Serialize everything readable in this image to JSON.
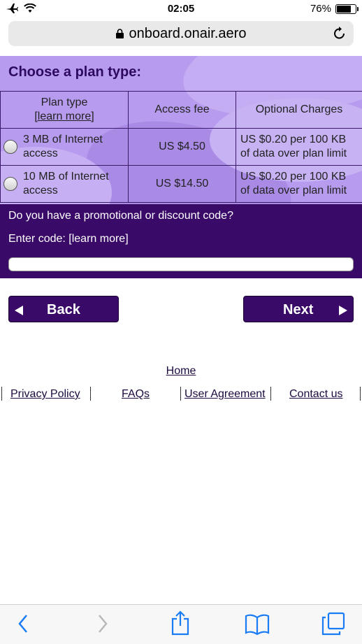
{
  "status": {
    "time": "02:05",
    "battery": "76%",
    "battery_level": 0.76
  },
  "browser": {
    "url": "onboard.onair.aero"
  },
  "plans": {
    "title": "Choose a plan type:",
    "headers": {
      "plan": "Plan type",
      "learn_more": "[learn more]",
      "fee": "Access fee",
      "charges": "Optional Charges"
    },
    "rows": [
      {
        "name_line1": "3 MB of Internet",
        "name_line2": "access",
        "fee": "US $4.50",
        "charge_line1": "US $0.20 per 100 KB",
        "charge_line2": "of data over plan limit"
      },
      {
        "name_line1": "10 MB of Internet",
        "name_line2": "access",
        "fee": "US $14.50",
        "charge_line1": "US $0.20 per 100 KB",
        "charge_line2": "of data over plan limit"
      }
    ]
  },
  "promo": {
    "question": "Do you have a promotional or discount code?",
    "enter_label": "Enter code: [learn more]",
    "code_value": ""
  },
  "nav": {
    "back": "Back",
    "next": "Next"
  },
  "footer": {
    "home": "Home",
    "privacy": "Privacy Policy",
    "faqs": "FAQs",
    "agreement": "User Agreement",
    "contact": "Contact us"
  },
  "colors": {
    "panel": "#b79bee",
    "dark_purple": "#3a0a68",
    "accent_blue": "#1a7cf5"
  }
}
